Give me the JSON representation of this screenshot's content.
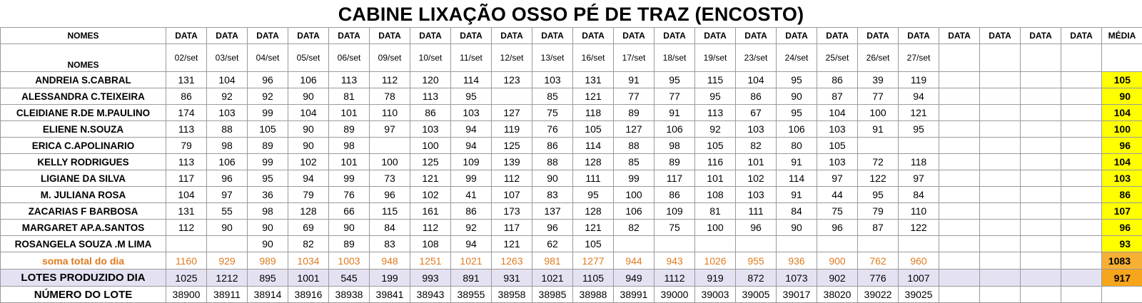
{
  "title": "CABINE LIXAÇÃO OSSO PÉ DE TRAZ (ENCOSTO)",
  "header": {
    "names_label": "NOMES",
    "data_label": "DATA",
    "media_label": "MÉDIA",
    "dates": [
      "02/set",
      "03/set",
      "04/set",
      "05/set",
      "06/set",
      "09/set",
      "10/set",
      "11/set",
      "12/set",
      "13/set",
      "16/set",
      "17/set",
      "18/set",
      "19/set",
      "23/set",
      "24/set",
      "25/set",
      "26/set",
      "27/set",
      "",
      "",
      "",
      ""
    ]
  },
  "rows": [
    {
      "name": "ANDREIA S.CABRAL",
      "values": [
        "131",
        "104",
        "96",
        "106",
        "113",
        "112",
        "120",
        "114",
        "123",
        "103",
        "131",
        "91",
        "95",
        "115",
        "104",
        "95",
        "86",
        "39",
        "119",
        "",
        "",
        "",
        ""
      ],
      "avg": "105"
    },
    {
      "name": "ALESSANDRA C.TEIXEIRA",
      "values": [
        "86",
        "92",
        "92",
        "90",
        "81",
        "78",
        "113",
        "95",
        "",
        "85",
        "121",
        "77",
        "77",
        "95",
        "86",
        "90",
        "87",
        "77",
        "94",
        "",
        "",
        "",
        ""
      ],
      "avg": "90"
    },
    {
      "name": "CLEIDIANE R.DE M.PAULINO",
      "values": [
        "174",
        "103",
        "99",
        "104",
        "101",
        "110",
        "86",
        "103",
        "127",
        "75",
        "118",
        "89",
        "91",
        "113",
        "67",
        "95",
        "104",
        "100",
        "121",
        "",
        "",
        "",
        ""
      ],
      "avg": "104"
    },
    {
      "name": "ELIENE N.SOUZA",
      "values": [
        "113",
        "88",
        "105",
        "90",
        "89",
        "97",
        "103",
        "94",
        "119",
        "76",
        "105",
        "127",
        "106",
        "92",
        "103",
        "106",
        "103",
        "91",
        "95",
        "",
        "",
        "",
        ""
      ],
      "avg": "100"
    },
    {
      "name": "ERICA C.APOLINARIO",
      "values": [
        "79",
        "98",
        "89",
        "90",
        "98",
        "",
        "100",
        "94",
        "125",
        "86",
        "114",
        "88",
        "98",
        "105",
        "82",
        "80",
        "105",
        "",
        "",
        "",
        "",
        "",
        ""
      ],
      "avg": "96"
    },
    {
      "name": "KELLY RODRIGUES",
      "values": [
        "113",
        "106",
        "99",
        "102",
        "101",
        "100",
        "125",
        "109",
        "139",
        "88",
        "128",
        "85",
        "89",
        "116",
        "101",
        "91",
        "103",
        "72",
        "118",
        "",
        "",
        "",
        ""
      ],
      "avg": "104"
    },
    {
      "name": "LIGIANE DA SILVA",
      "values": [
        "117",
        "96",
        "95",
        "94",
        "99",
        "73",
        "121",
        "99",
        "112",
        "90",
        "111",
        "99",
        "117",
        "101",
        "102",
        "114",
        "97",
        "122",
        "97",
        "",
        "",
        "",
        ""
      ],
      "avg": "103"
    },
    {
      "name": "M. JULIANA ROSA",
      "values": [
        "104",
        "97",
        "36",
        "79",
        "76",
        "96",
        "102",
        "41",
        "107",
        "83",
        "95",
        "100",
        "86",
        "108",
        "103",
        "91",
        "44",
        "95",
        "84",
        "",
        "",
        "",
        ""
      ],
      "avg": "86"
    },
    {
      "name": "ZACARIAS F BARBOSA",
      "values": [
        "131",
        "55",
        "98",
        "128",
        "66",
        "115",
        "161",
        "86",
        "173",
        "137",
        "128",
        "106",
        "109",
        "81",
        "111",
        "84",
        "75",
        "79",
        "110",
        "",
        "",
        "",
        ""
      ],
      "avg": "107"
    },
    {
      "name": "MARGARET AP.A.SANTOS",
      "values": [
        "112",
        "90",
        "90",
        "69",
        "90",
        "84",
        "112",
        "92",
        "117",
        "96",
        "121",
        "82",
        "75",
        "100",
        "96",
        "90",
        "96",
        "87",
        "122",
        "",
        "",
        "",
        ""
      ],
      "avg": "96"
    },
    {
      "name": "ROSANGELA SOUZA .M LIMA",
      "values": [
        "",
        "",
        "90",
        "82",
        "89",
        "83",
        "108",
        "94",
        "121",
        "62",
        "105",
        "",
        "",
        "",
        "",
        "",
        "",
        "",
        "",
        "",
        "",
        "",
        ""
      ],
      "avg": "93"
    }
  ],
  "soma": {
    "label": "soma total  do dia",
    "values": [
      "1160",
      "929",
      "989",
      "1034",
      "1003",
      "948",
      "1251",
      "1021",
      "1263",
      "981",
      "1277",
      "944",
      "943",
      "1026",
      "955",
      "936",
      "900",
      "762",
      "960",
      "",
      "",
      "",
      ""
    ],
    "avg": "1083"
  },
  "lotes_dia": {
    "label": "LOTES PRODUZIDO DIA",
    "values": [
      "1025",
      "1212",
      "895",
      "1001",
      "545",
      "199",
      "993",
      "891",
      "931",
      "1021",
      "1105",
      "949",
      "1112",
      "919",
      "872",
      "1073",
      "902",
      "776",
      "1007",
      "",
      "",
      "",
      ""
    ],
    "avg": "917"
  },
  "numero_lote": {
    "label": "NÚMERO DO LOTE",
    "values": [
      "38900",
      "38911",
      "38914",
      "38916",
      "38938",
      "39841",
      "38943",
      "38955",
      "38958",
      "38985",
      "38988",
      "38991",
      "39000",
      "39003",
      "39005",
      "39017",
      "38020",
      "39022",
      "39025",
      "",
      "",
      "",
      ""
    ]
  },
  "colors": {
    "avg_highlight": "#ffff00",
    "soma_text": "#e07a1f",
    "soma_avg": "#f7b034",
    "lotes_row_bg": "#e4e2f2",
    "lotes_avg": "#f7a51a"
  }
}
